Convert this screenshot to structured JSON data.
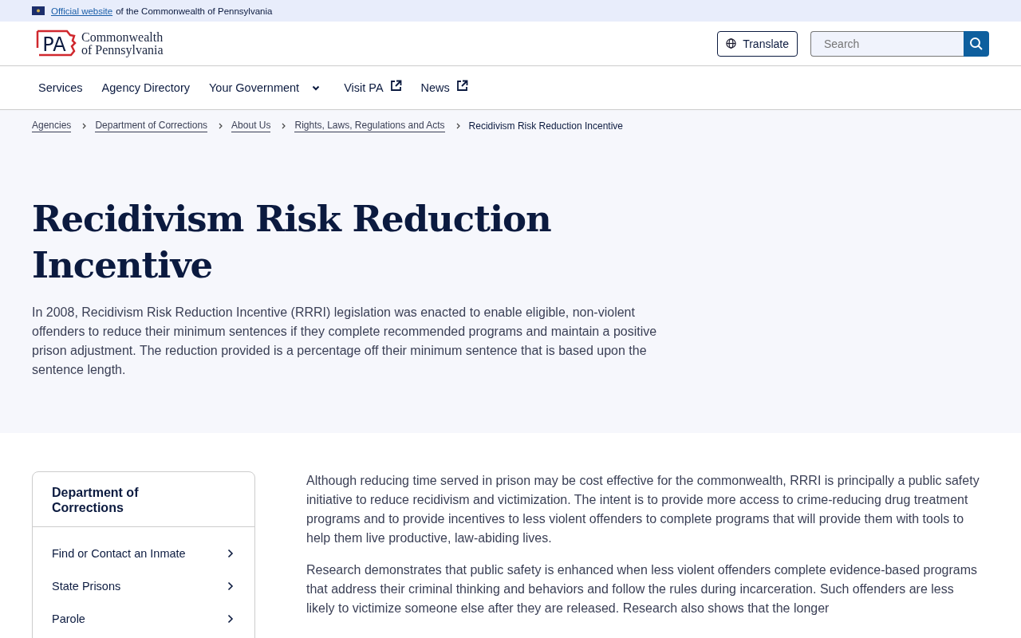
{
  "official_bar": {
    "link": "Official website",
    "text": "of the Commonwealth of Pennsylvania"
  },
  "header": {
    "logo_mark": "PA",
    "logo_line1": "Commonwealth",
    "logo_line2": "of Pennsylvania",
    "translate": "Translate",
    "search": {
      "placeholder": "Search"
    }
  },
  "nav": [
    {
      "label": "Services",
      "kind": "plain"
    },
    {
      "label": "Agency Directory",
      "kind": "plain"
    },
    {
      "label": "Your Government",
      "kind": "dropdown"
    },
    {
      "label": "Visit PA",
      "kind": "external"
    },
    {
      "label": "News",
      "kind": "external"
    }
  ],
  "breadcrumbs": [
    {
      "label": "Agencies",
      "current": false
    },
    {
      "label": "Department of Corrections",
      "current": false
    },
    {
      "label": "About Us",
      "current": false
    },
    {
      "label": "Rights, Laws, Regulations and Acts",
      "current": false
    },
    {
      "label": "Recidivism Risk Reduction Incentive",
      "current": true
    }
  ],
  "title": "Recidivism Risk Reduction Incentive",
  "intro": "In 2008, Recidivism Risk Reduction Incentive (RRRI) legislation was enacted to enable eligible, non-violent offenders to reduce their minimum sentences if they complete recommended programs and maintain a positive prison adjustment. The reduction provided is a percentage off their minimum sentence that is based upon the sentence length.",
  "side_nav": {
    "title": "Department of Corrections",
    "items": [
      "Find or Contact an Inmate",
      "State Prisons",
      "Parole"
    ]
  },
  "body": [
    "Although reducing time served in prison may be cost effective for the commonwealth, RRRI is principally a public safety initiative to reduce recidivism and victimization. The intent is to provide more access to crime-reducing drug treatment programs and to provide incentives to less violent offenders to complete programs that will provide them with tools to help them live productive, law-abiding lives.",
    "Research demonstrates that public safety is enhanced when less violent offenders complete evidence-based programs that address their criminal thinking and behaviors and follow the rules during incarceration. Such offenders are less likely to victimize someone else after they are released. Research also shows that the longer"
  ]
}
